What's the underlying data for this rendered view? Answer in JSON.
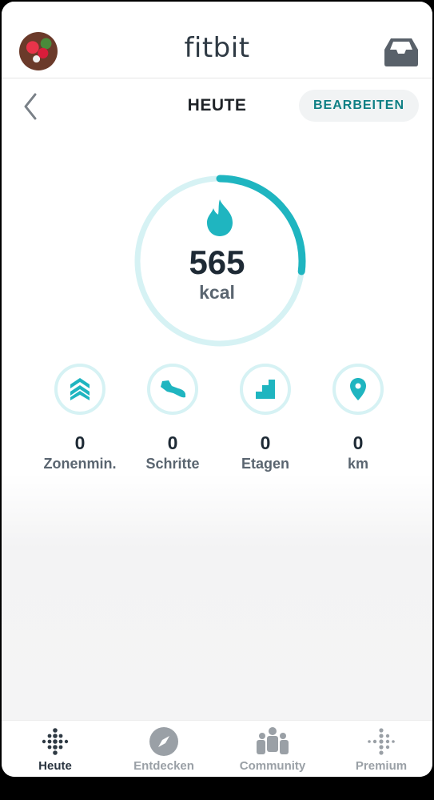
{
  "header": {
    "brand": "fitbit"
  },
  "subheader": {
    "title": "HEUTE",
    "edit_label": "BEARBEITEN"
  },
  "calories": {
    "value": "565",
    "unit": "kcal",
    "progress": 0.27
  },
  "stats": [
    {
      "value": "0",
      "label": "Zonenmin.",
      "icon": "chevrons-up-icon"
    },
    {
      "value": "0",
      "label": "Schritte",
      "icon": "shoe-icon"
    },
    {
      "value": "0",
      "label": "Etagen",
      "icon": "stairs-icon"
    },
    {
      "value": "0",
      "label": "km",
      "icon": "location-pin-icon"
    }
  ],
  "tabs": [
    {
      "label": "Heute",
      "active": true
    },
    {
      "label": "Entdecken",
      "active": false
    },
    {
      "label": "Community",
      "active": false
    },
    {
      "label": "Premium",
      "active": false
    }
  ],
  "colors": {
    "accent": "#1fb5c0",
    "ring_track": "#d6f2f4",
    "edit_text": "#0e7f84"
  }
}
